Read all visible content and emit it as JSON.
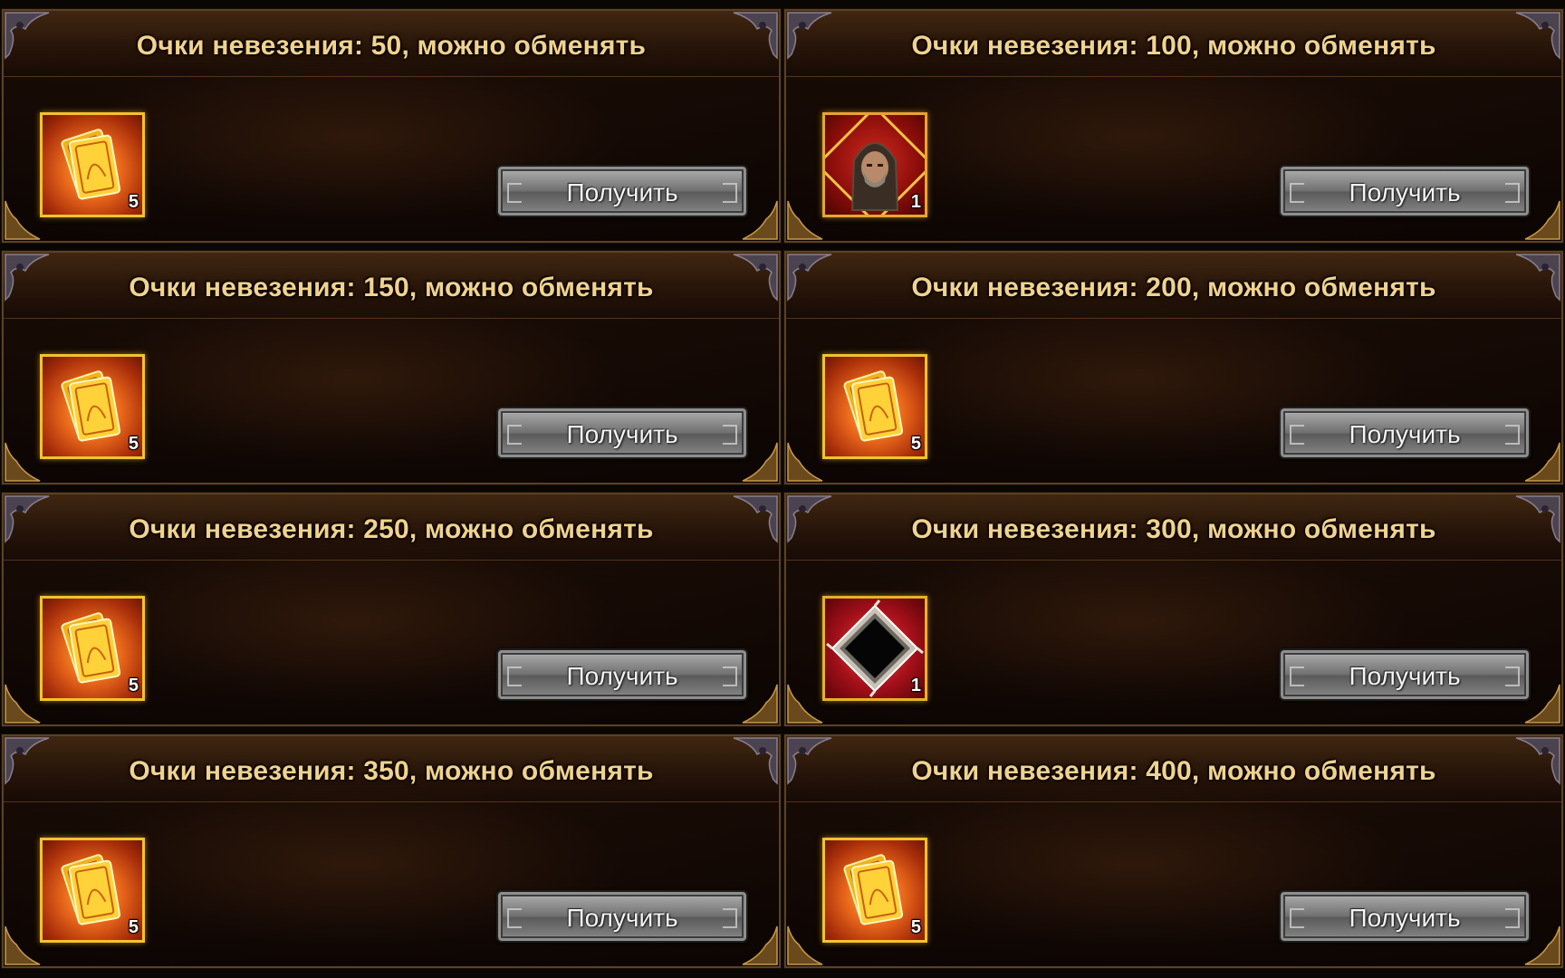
{
  "colors": {
    "title_text": "#f1d28e",
    "item_border_gold": "#f3c22c",
    "button_silver": "#8e8e8e",
    "panel_bg": "#120804"
  },
  "rewards": [
    {
      "title": "Очки невезения: 50, можно обменять",
      "item_icon": "card-pack-icon",
      "quantity": "5",
      "button_label": "Получить"
    },
    {
      "title": "Очки невезения: 100, можно обменять",
      "item_icon": "hooded-hero-portrait",
      "quantity": "1",
      "button_label": "Получить"
    },
    {
      "title": "Очки невезения: 150, можно обменять",
      "item_icon": "card-pack-icon",
      "quantity": "5",
      "button_label": "Получить"
    },
    {
      "title": "Очки невезения: 200, можно обменять",
      "item_icon": "card-pack-icon",
      "quantity": "5",
      "button_label": "Получить"
    },
    {
      "title": "Очки невезения: 250, можно обменять",
      "item_icon": "card-pack-icon",
      "quantity": "5",
      "button_label": "Получить"
    },
    {
      "title": "Очки невезения: 300, можно обменять",
      "item_icon": "black-diamond-gem-icon",
      "quantity": "1",
      "button_label": "Получить"
    },
    {
      "title": "Очки невезения: 350, можно обменять",
      "item_icon": "card-pack-icon",
      "quantity": "5",
      "button_label": "Получить"
    },
    {
      "title": "Очки невезения: 400, можно обменять",
      "item_icon": "card-pack-icon",
      "quantity": "5",
      "button_label": "Получить"
    }
  ]
}
